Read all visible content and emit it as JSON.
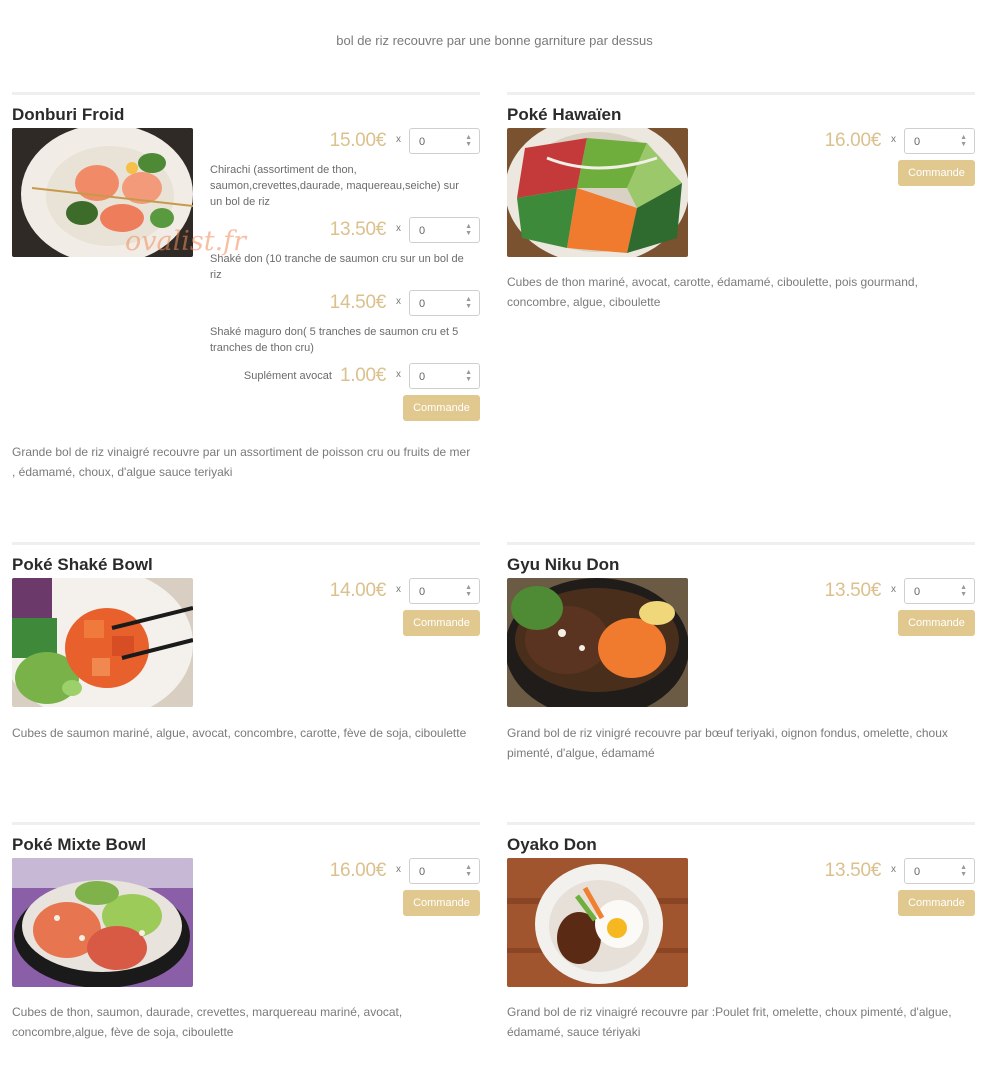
{
  "intro": "bol de riz recouvre par une bonne garniture par dessus",
  "watermark": "ovalist.fr",
  "currency_times": "x",
  "colors": {
    "price": "#dbc18d",
    "button": "#e1c88f",
    "title": "#2b2b2b",
    "text": "#7a7a7a"
  },
  "cards": [
    {
      "title": "Donburi Froid",
      "options": [
        {
          "price": "15.00€",
          "qty": "0",
          "desc": "Chirachi (assortiment de thon, saumon,crevettes,daurade, maquereau,seiche) sur un bol de riz"
        },
        {
          "price": "13.50€",
          "qty": "0",
          "desc": "Shaké don (10 tranche de saumon cru sur un bol de riz"
        },
        {
          "price": "14.50€",
          "qty": "0",
          "desc": "Shaké maguro don( 5 tranches de saumon cru et 5 tranches de thon cru)"
        },
        {
          "label": "Suplément avocat",
          "price": "1.00€",
          "qty": "0"
        }
      ],
      "button": "Commande",
      "description": "Grande bol de riz vinaigré recouvre par un assortiment de poisson cru ou fruits de mer , édamamé, choux, d'algue sauce teriyaki"
    },
    {
      "title": "Poké Hawaïen",
      "options": [
        {
          "price": "16.00€",
          "qty": "0"
        }
      ],
      "button": "Commande",
      "description": "Cubes de thon mariné, avocat, carotte, édamamé, ciboulette, pois gourmand, concombre, algue, ciboulette"
    },
    {
      "title": "Poké Shaké Bowl",
      "options": [
        {
          "price": "14.00€",
          "qty": "0"
        }
      ],
      "button": "Commande",
      "description": "Cubes de saumon mariné, algue, avocat, concombre, carotte, fève de soja, ciboulette"
    },
    {
      "title": "Gyu Niku Don",
      "options": [
        {
          "price": "13.50€",
          "qty": "0"
        }
      ],
      "button": "Commande",
      "description": "Grand bol de riz vinigré recouvre par bœuf teriyaki, oignon fondus, omelette, choux pimenté, d'algue, édamamé"
    },
    {
      "title": "Poké Mixte Bowl",
      "options": [
        {
          "price": "16.00€",
          "qty": "0"
        }
      ],
      "button": "Commande",
      "description": "Cubes de thon, saumon, daurade, crevettes, marquereau mariné, avocat, concombre,algue, fève de soja, ciboulette"
    },
    {
      "title": "Oyako Don",
      "options": [
        {
          "price": "13.50€",
          "qty": "0"
        }
      ],
      "button": "Commande",
      "description": "Grand bol de riz vinaigré recouvre par :Poulet frit, omelette, choux pimenté, d'algue, édamamé, sauce tériyaki"
    }
  ]
}
